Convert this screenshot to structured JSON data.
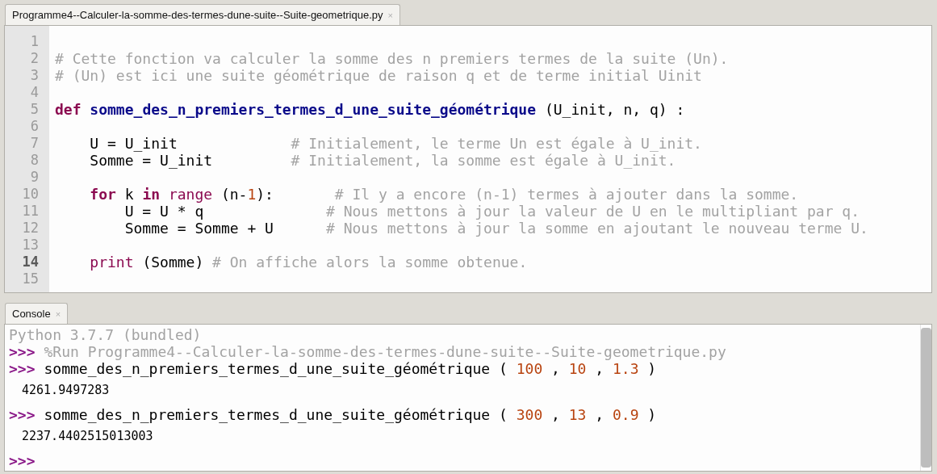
{
  "editor": {
    "tab": {
      "label": "Programme4--Calculer-la-somme-des-termes-dune-suite--Suite-geometrique.py",
      "close": "×",
      "selected": true
    },
    "lines": [
      {
        "number": "1",
        "current": false
      },
      {
        "number": "2",
        "current": false,
        "tokens": [
          {
            "kind": "comment",
            "text": "# Cette fonction va calculer la somme des n premiers termes de la suite (Un)."
          }
        ]
      },
      {
        "number": "3",
        "current": false,
        "tokens": [
          {
            "kind": "comment",
            "text": "# (Un) est ici une suite géométrique de raison q et de terme initial Uinit"
          }
        ]
      },
      {
        "number": "4",
        "current": false
      },
      {
        "number": "5",
        "current": false,
        "tokens": [
          {
            "kind": "keyword",
            "text": "def "
          },
          {
            "kind": "function",
            "text": "somme_des_n_premiers_termes_d_une_suite_géométrique"
          },
          {
            "kind": "plain",
            "text": " (U_init, n, q) :"
          }
        ]
      },
      {
        "number": "6",
        "current": false
      },
      {
        "number": "7",
        "current": false,
        "tokens": [
          {
            "kind": "plain",
            "text": "    U = U_init             "
          },
          {
            "kind": "comment",
            "text": "# Initialement, le terme Un est égale à U_init."
          }
        ]
      },
      {
        "number": "8",
        "current": false,
        "tokens": [
          {
            "kind": "plain",
            "text": "    Somme = U_init         "
          },
          {
            "kind": "comment",
            "text": "# Initialement, la somme est égale à U_init."
          }
        ]
      },
      {
        "number": "9",
        "current": false
      },
      {
        "number": "10",
        "current": false,
        "tokens": [
          {
            "kind": "keyword",
            "text": "    for"
          },
          {
            "kind": "plain",
            "text": " k "
          },
          {
            "kind": "keyword",
            "text": "in "
          },
          {
            "kind": "builtin",
            "text": "range"
          },
          {
            "kind": "plain",
            "text": " (n-"
          },
          {
            "kind": "number",
            "text": "1"
          },
          {
            "kind": "plain",
            "text": "):       "
          },
          {
            "kind": "comment",
            "text": "# Il y a encore (n-1) termes à ajouter dans la somme."
          }
        ]
      },
      {
        "number": "11",
        "current": false,
        "tokens": [
          {
            "kind": "plain",
            "text": "        U = U * q              "
          },
          {
            "kind": "comment",
            "text": "# Nous mettons à jour la valeur de U en le multipliant par q."
          }
        ]
      },
      {
        "number": "12",
        "current": false,
        "tokens": [
          {
            "kind": "plain",
            "text": "        Somme = Somme + U      "
          },
          {
            "kind": "comment",
            "text": "# Nous mettons à jour la somme en ajoutant le nouveau terme U."
          }
        ]
      },
      {
        "number": "13",
        "current": false
      },
      {
        "number": "14",
        "current": true,
        "tokens": [
          {
            "kind": "builtin",
            "text": "    print"
          },
          {
            "kind": "plain",
            "text": " (Somme) "
          },
          {
            "kind": "comment",
            "text": "# On affiche alors la somme obtenue."
          }
        ]
      },
      {
        "number": "15",
        "current": false
      }
    ]
  },
  "console": {
    "tab": {
      "label": "Console",
      "close": "×",
      "selected": true
    },
    "lines": [
      {
        "kind": "info",
        "text": "Python 3.7.7 (bundled)"
      },
      {
        "kind": "input",
        "prompt": ">>>",
        "tokens": [
          {
            "kind": "comment",
            "text": "%Run Programme4--Calculer-la-somme-des-termes-dune-suite--Suite-geometrique.py"
          }
        ]
      },
      {
        "kind": "input",
        "prompt": ">>>",
        "tokens": [
          {
            "kind": "plain",
            "text": "somme_des_n_premiers_termes_d_une_suite_géométrique ( "
          },
          {
            "kind": "number",
            "text": "100"
          },
          {
            "kind": "plain",
            "text": " , "
          },
          {
            "kind": "number",
            "text": "10"
          },
          {
            "kind": "plain",
            "text": " , "
          },
          {
            "kind": "number",
            "text": "1.3"
          },
          {
            "kind": "plain",
            "text": " )"
          }
        ]
      },
      {
        "kind": "output",
        "text": "4261.9497283"
      },
      {
        "kind": "input",
        "prompt": ">>>",
        "tokens": [
          {
            "kind": "plain",
            "text": "somme_des_n_premiers_termes_d_une_suite_géométrique ( "
          },
          {
            "kind": "number",
            "text": "300"
          },
          {
            "kind": "plain",
            "text": " , "
          },
          {
            "kind": "number",
            "text": "13"
          },
          {
            "kind": "plain",
            "text": " , "
          },
          {
            "kind": "number",
            "text": "0.9"
          },
          {
            "kind": "plain",
            "text": " )"
          }
        ]
      },
      {
        "kind": "output",
        "text": "2237.4402515013003"
      },
      {
        "kind": "input",
        "prompt": ">>>"
      }
    ]
  }
}
